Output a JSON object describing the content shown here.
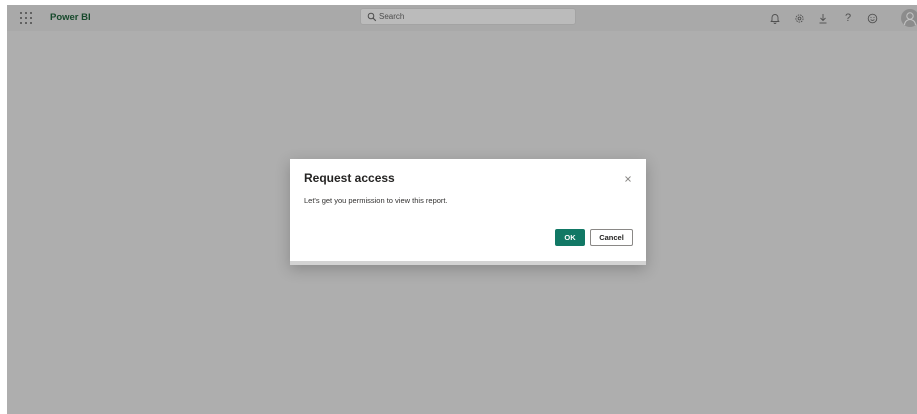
{
  "header": {
    "app_name": "Power BI",
    "search_placeholder": "Search",
    "icons": [
      "notifications-icon",
      "settings-icon",
      "download-icon",
      "help-icon",
      "feedback-icon",
      "account-icon"
    ],
    "help_glyph": "?"
  },
  "dialog": {
    "title": "Request access",
    "message": "Let's get you permission to view this report.",
    "ok_label": "OK",
    "cancel_label": "Cancel",
    "close_glyph": "×"
  },
  "colors": {
    "brand_text": "#17492c",
    "primary_button": "#117865",
    "overlay": "#aeaeae"
  }
}
